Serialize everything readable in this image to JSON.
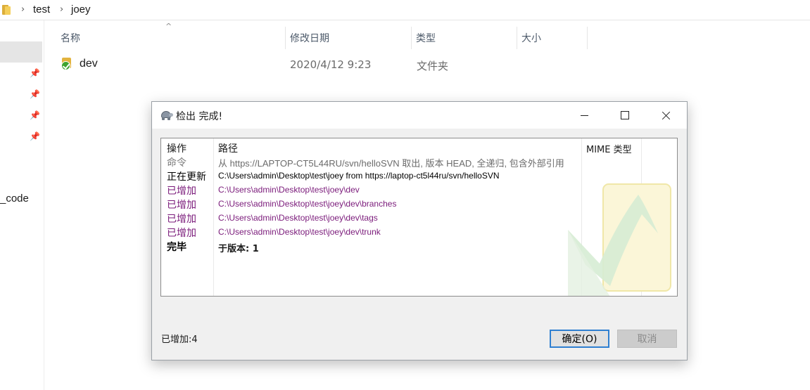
{
  "breadcrumb": {
    "items": [
      "test",
      "joey"
    ]
  },
  "nav": {
    "partial_label": "_code"
  },
  "columns": {
    "name": "名称",
    "date": "修改日期",
    "type": "类型",
    "size": "大小"
  },
  "files": [
    {
      "name": "dev",
      "date": "2020/4/12 9:23",
      "type": "文件夹",
      "icon": "svn-folder-normal-icon"
    }
  ],
  "dialog": {
    "title": "检出 完成!",
    "log": {
      "headers": {
        "action": "操作",
        "path": "路径",
        "mime": "MIME 类型"
      },
      "rows": [
        {
          "action": "命令",
          "path": "从 https://LAPTOP-CT5L44RU/svn/helloSVN 取出, 版本 HEAD, 全递归, 包含外部引用",
          "kind": "cmd"
        },
        {
          "action": "正在更新",
          "path": "C:\\Users\\admin\\Desktop\\test\\joey from https://laptop-ct5l44ru/svn/helloSVN",
          "kind": "upd"
        },
        {
          "action": "已增加",
          "path": "C:\\Users\\admin\\Desktop\\test\\joey\\dev",
          "kind": "add"
        },
        {
          "action": "已增加",
          "path": "C:\\Users\\admin\\Desktop\\test\\joey\\dev\\branches",
          "kind": "add"
        },
        {
          "action": "已增加",
          "path": "C:\\Users\\admin\\Desktop\\test\\joey\\dev\\tags",
          "kind": "add"
        },
        {
          "action": "已增加",
          "path": "C:\\Users\\admin\\Desktop\\test\\joey\\dev\\trunk",
          "kind": "add"
        },
        {
          "action": "完毕",
          "path": "于版本: 1",
          "kind": "done"
        }
      ]
    },
    "status": "已增加:4",
    "ok_label": "确定(O)",
    "cancel_label": "取消"
  },
  "colors": {
    "accent": "#2f7fd1",
    "added": "#7a1a7a",
    "command": "#7a7a7a"
  }
}
